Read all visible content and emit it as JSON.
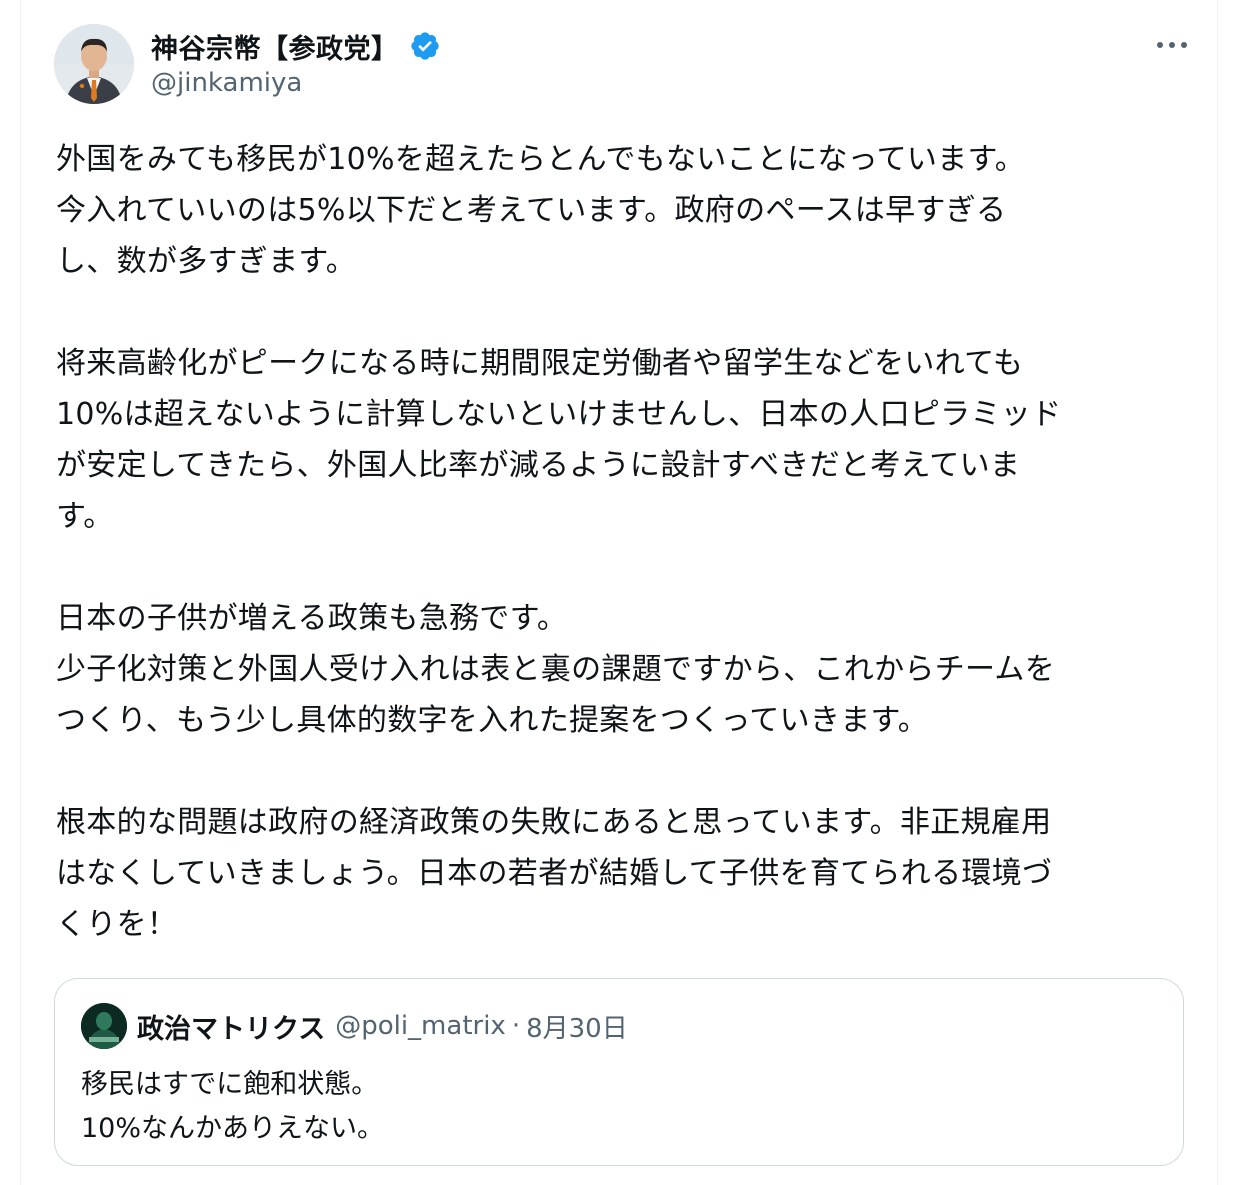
{
  "author": {
    "display_name": "神谷宗幣【参政党】",
    "handle": "@jinkamiya",
    "verified": true,
    "verified_color": "#1d9bf0"
  },
  "more_icon": "ellipsis-icon",
  "post": {
    "text": "外国をみても移民が10%を超えたらとんでもないことになっています。\n今入れていいのは5%以下だと考えています。政府のペースは早すぎる\nし、数が多すぎます。\n\n将来高齢化がピークになる時に期間限定労働者や留学生などをいれても\n10%は超えないように計算しないといけませんし、日本の人口ピラミッド\nが安定してきたら、外国人比率が減るように設計すべきだと考えていま\nす。\n\n日本の子供が増える政策も急務です。\n少子化対策と外国人受け入れは表と裏の課題ですから、これからチームを\nつくり、もう少し具体的数字を入れた提案をつくっていきます。\n\n根本的な問題は政府の経済政策の失敗にあると思っています。非正規雇用\nはなくしていきましょう。日本の若者が結婚して子供を育てられる環境づ\nくりを！"
  },
  "quote": {
    "display_name": "政治マトリクス",
    "handle": "@poli_matrix",
    "separator": "·",
    "date": "8月30日",
    "text": "移民はすでに飽和状態。\n10%なんかありえない。"
  },
  "colors": {
    "text": "#0f1419",
    "secondary": "#536471",
    "border": "#cfd9de"
  }
}
